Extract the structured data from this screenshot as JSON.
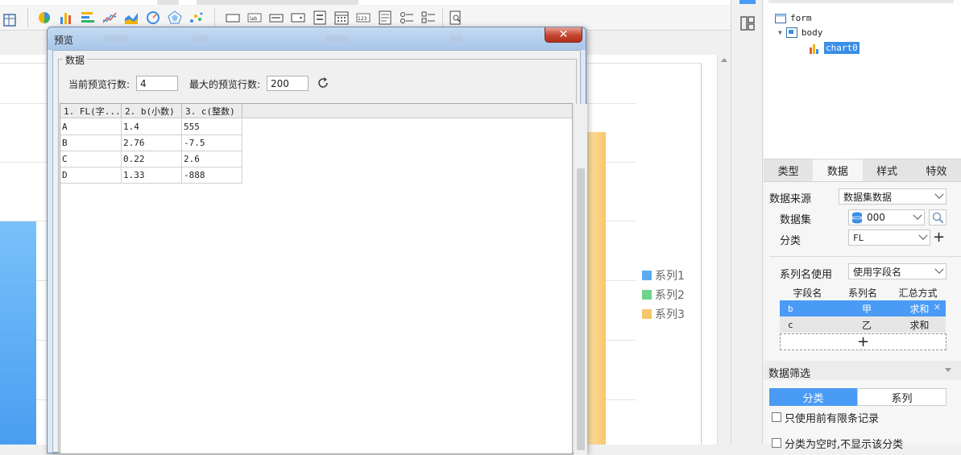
{
  "dialog": {
    "title": "预览",
    "close_label": "✕",
    "group_title": "数据",
    "current_rows_label": "当前预览行数:",
    "current_rows_value": "4",
    "max_rows_label": "最大的预览行数:",
    "max_rows_value": "200",
    "columns": [
      "1. FL(字...",
      "2. b(小数)",
      "3. c(整数)"
    ],
    "rows": [
      [
        "A",
        "1.4",
        "555"
      ],
      [
        "B",
        "2.76",
        "-7.5"
      ],
      [
        "C",
        "0.22",
        "2.6"
      ],
      [
        "D",
        "1.33",
        "-888"
      ]
    ]
  },
  "chart_legend": [
    {
      "name": "系列1",
      "color": "#5aabf0"
    },
    {
      "name": "系列2",
      "color": "#6fd38a"
    },
    {
      "name": "系列3",
      "color": "#f7c56a"
    }
  ],
  "tree": {
    "form": "form",
    "body": "body",
    "chart": "chart0"
  },
  "props": {
    "tabs": [
      "类型",
      "数据",
      "样式",
      "特效"
    ],
    "active_tab": "数据",
    "datasource_label": "数据来源",
    "datasource_value": "数据集数据",
    "dataset_label": "数据集",
    "dataset_value": "000",
    "category_label": "分类",
    "category_value": "FL",
    "series_name_label": "系列名使用",
    "series_name_value": "使用字段名",
    "series_table_headers": [
      "字段名",
      "系列名",
      "汇总方式"
    ],
    "series_rows": [
      [
        "b",
        "甲",
        "求和"
      ],
      [
        "c",
        "乙",
        "求和"
      ]
    ],
    "add_label": "+",
    "filter_title": "数据筛选",
    "filter_tabs": [
      "分类",
      "系列"
    ],
    "limit_label": "只使用前有限条记录",
    "empty_label": "分类为空时,不显示该分类"
  },
  "colors": {
    "accent": "#4a9bf5",
    "selected_row": "#4a9bf5"
  }
}
